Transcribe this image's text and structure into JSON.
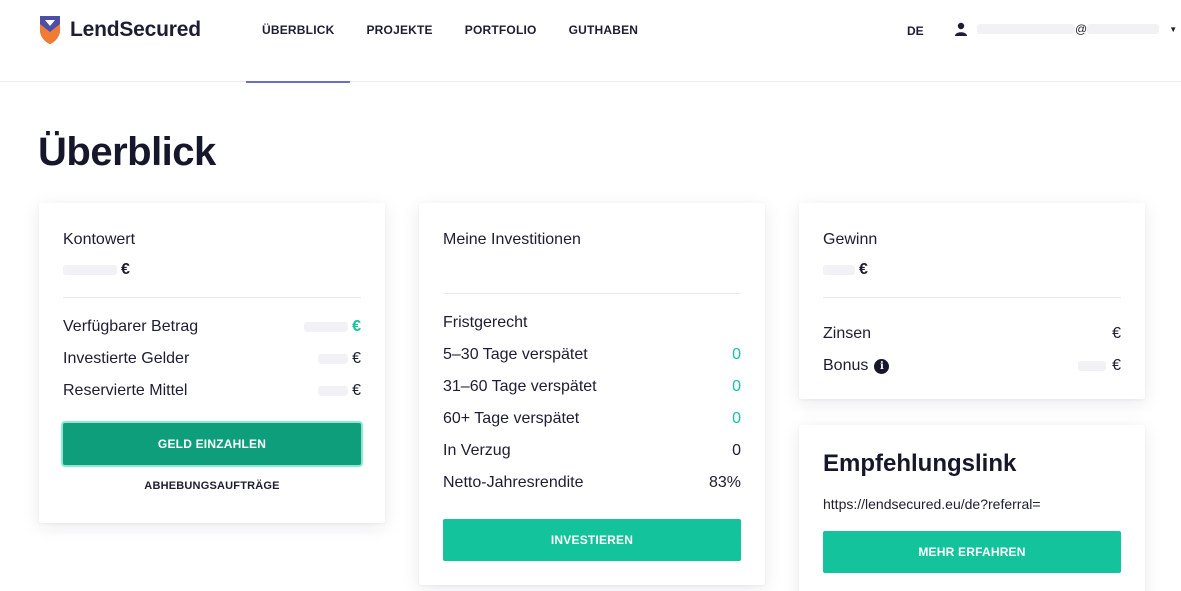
{
  "header": {
    "brand": "LendSecured",
    "nav": [
      {
        "label": "ÜBERBLICK",
        "active": true
      },
      {
        "label": "PROJEKTE",
        "active": false
      },
      {
        "label": "PORTFOLIO",
        "active": false
      },
      {
        "label": "GUTHABEN",
        "active": false
      }
    ],
    "language": "DE",
    "user_email_visible": "@",
    "user_icon": "user-icon"
  },
  "page_title": "Überblick",
  "account_card": {
    "title": "Kontowert",
    "value_currency": "€",
    "rows": [
      {
        "label": "Verfügbarer Betrag",
        "currency": "€",
        "highlight": true
      },
      {
        "label": "Investierte Gelder",
        "currency": "€",
        "highlight": false
      },
      {
        "label": "Reservierte Mittel",
        "currency": "€",
        "highlight": false
      }
    ],
    "deposit_button": "GELD EINZAHLEN",
    "withdraw_link": "ABHEBUNGSAUFTRÄGE"
  },
  "investments_card": {
    "title": "Meine Investitionen",
    "rows": [
      {
        "label": "Fristgerecht",
        "value": ""
      },
      {
        "label": "5–30 Tage verspätet",
        "value": "0",
        "highlight": true
      },
      {
        "label": "31–60 Tage verspätet",
        "value": "0",
        "highlight": true
      },
      {
        "label": "60+ Tage verspätet",
        "value": "0",
        "highlight": true
      },
      {
        "label": "In Verzug",
        "value": "0",
        "highlight": false
      },
      {
        "label": "Netto-Jahresrendite",
        "value": "83%",
        "highlight": false
      }
    ],
    "invest_button": "INVESTIEREN"
  },
  "profit_card": {
    "title": "Gewinn",
    "value_currency": "€",
    "rows": [
      {
        "label": "Zinsen",
        "currency": "€"
      },
      {
        "label": "Bonus",
        "currency": "€",
        "info_icon": "info-icon"
      }
    ]
  },
  "referral_card": {
    "title": "Empfehlungslink",
    "link": "https://lendsecured.eu/de?referral=",
    "learn_more_button": "MEHR ERFAHREN"
  },
  "colors": {
    "accent": "#12c39c",
    "accent_dark": "#0e9e7c",
    "text": "#1d1d33",
    "nav_underline": "#6a6ec8"
  }
}
